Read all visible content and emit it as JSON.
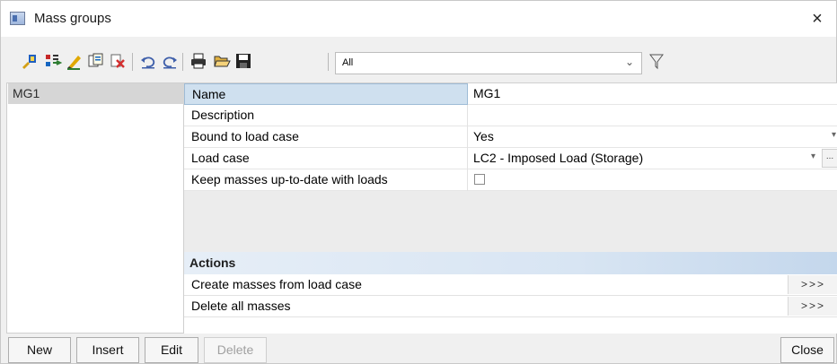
{
  "window": {
    "title": "Mass groups",
    "close_glyph": "×"
  },
  "toolbar": {
    "icons": [
      "new-item-icon",
      "insert-icon",
      "edit-icon",
      "copy-icon",
      "delete-icon",
      "undo-icon",
      "redo-icon",
      "print-icon",
      "open-icon",
      "save-icon",
      "filter-icon"
    ],
    "filter_value": "All",
    "filter_caret": "⌄"
  },
  "list": {
    "items": [
      "MG1"
    ]
  },
  "properties": [
    {
      "name": "Name",
      "value": "MG1"
    },
    {
      "name": "Description",
      "value": ""
    },
    {
      "name": "Bound to load case",
      "value": "Yes"
    },
    {
      "name": "Load case",
      "value": "LC2 - Imposed Load (Storage)"
    },
    {
      "name": "Keep masses up-to-date with loads",
      "value": ""
    }
  ],
  "ellipsis_label": "...",
  "actions": {
    "header": "Actions",
    "items": [
      {
        "label": "Create masses from load case",
        "button": ">>>"
      },
      {
        "label": "Delete all masses",
        "button": ">>>"
      }
    ]
  },
  "buttons": {
    "new": "New",
    "insert": "Insert",
    "edit": "Edit",
    "delete": "Delete",
    "close": "Close"
  },
  "colors": {
    "selection": "#cfe0ef",
    "actions_header": "#d8e5f3"
  }
}
